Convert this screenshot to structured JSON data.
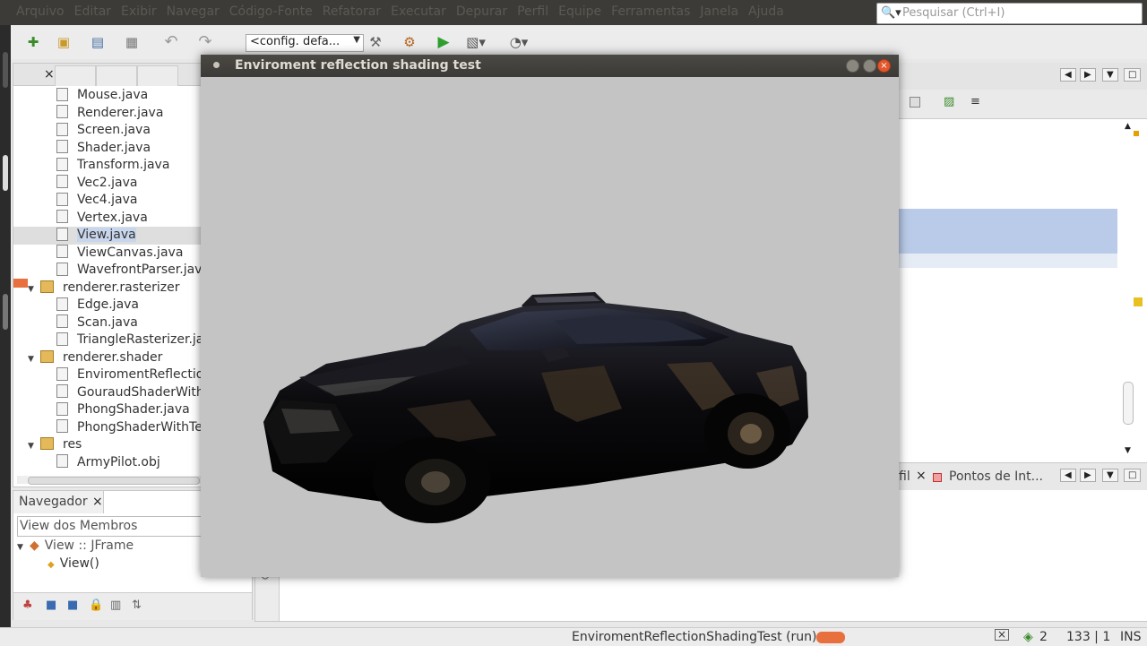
{
  "menu": [
    "Arquivo",
    "Editar",
    "Exibir",
    "Navegar",
    "Código-Fonte",
    "Refatorar",
    "Executar",
    "Depurar",
    "Perfil",
    "Equipe",
    "Ferramentas",
    "Janela",
    "Ajuda"
  ],
  "search": {
    "placeholder": "Pesquisar (Ctrl+I)"
  },
  "toolbar": {
    "config_value": "<config. defa...",
    "undo_icon": "undo-icon",
    "redo_icon": "redo-icon"
  },
  "project_tree": {
    "close_symbol": "×",
    "items": [
      {
        "label": "Mouse.java",
        "type": "file"
      },
      {
        "label": "Renderer.java",
        "type": "file"
      },
      {
        "label": "Screen.java",
        "type": "file"
      },
      {
        "label": "Shader.java",
        "type": "file"
      },
      {
        "label": "Transform.java",
        "type": "file"
      },
      {
        "label": "Vec2.java",
        "type": "file"
      },
      {
        "label": "Vec4.java",
        "type": "file"
      },
      {
        "label": "Vertex.java",
        "type": "file"
      },
      {
        "label": "View.java",
        "type": "file",
        "selected": true
      },
      {
        "label": "ViewCanvas.java",
        "type": "file"
      },
      {
        "label": "WavefrontParser.java",
        "type": "file"
      },
      {
        "label": "renderer.rasterizer",
        "type": "package"
      },
      {
        "label": "Edge.java",
        "type": "file"
      },
      {
        "label": "Scan.java",
        "type": "file"
      },
      {
        "label": "TriangleRasterizer.java",
        "type": "file"
      },
      {
        "label": "renderer.shader",
        "type": "package"
      },
      {
        "label": "EnviromentReflectionShader.java",
        "type": "file"
      },
      {
        "label": "GouraudShaderWithTexture.java",
        "type": "file"
      },
      {
        "label": "PhongShader.java",
        "type": "file"
      },
      {
        "label": "PhongShaderWithTexture.java",
        "type": "file"
      },
      {
        "label": "res",
        "type": "package"
      },
      {
        "label": "ArmyPilot.obj",
        "type": "plain"
      }
    ]
  },
  "navigator": {
    "tab_label": "Navegador",
    "close_symbol": "×",
    "filter_value": "View dos Membros",
    "class_item": "View :: JFrame",
    "member_item": "View()"
  },
  "output": {
    "tab_partial": "fil",
    "tab_breakpoints": "Pontos de Int..."
  },
  "window": {
    "title": "Enviroment reflection shading test"
  },
  "status": {
    "task": "EnviromentReflectionShadingTest (run)",
    "notifications": "2",
    "position": "133 | 1",
    "mode": "INS"
  }
}
